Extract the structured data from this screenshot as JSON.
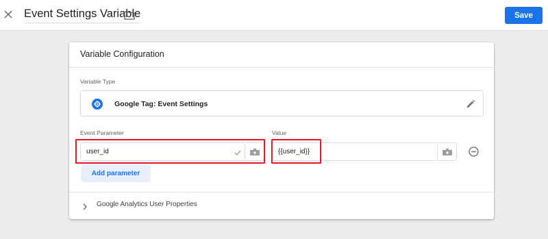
{
  "header": {
    "title": "Event Settings Variable",
    "save_label": "Save",
    "accent": "#1a73e8"
  },
  "card": {
    "title": "Variable Configuration",
    "variable_type_label": "Variable Type",
    "variable_type_value": "Google Tag: Event Settings",
    "variable_type_icon": "gear-icon",
    "event_parameter_label": "Event Parameter",
    "value_label": "Value",
    "parameters": [
      {
        "name": "user_id",
        "value": "{{user_id}}"
      }
    ],
    "add_parameter_label": "Add parameter",
    "section": {
      "label": "Google Analytics User Properties",
      "collapsed": true
    }
  },
  "annotation": {
    "highlight_color": "#e21b22"
  }
}
